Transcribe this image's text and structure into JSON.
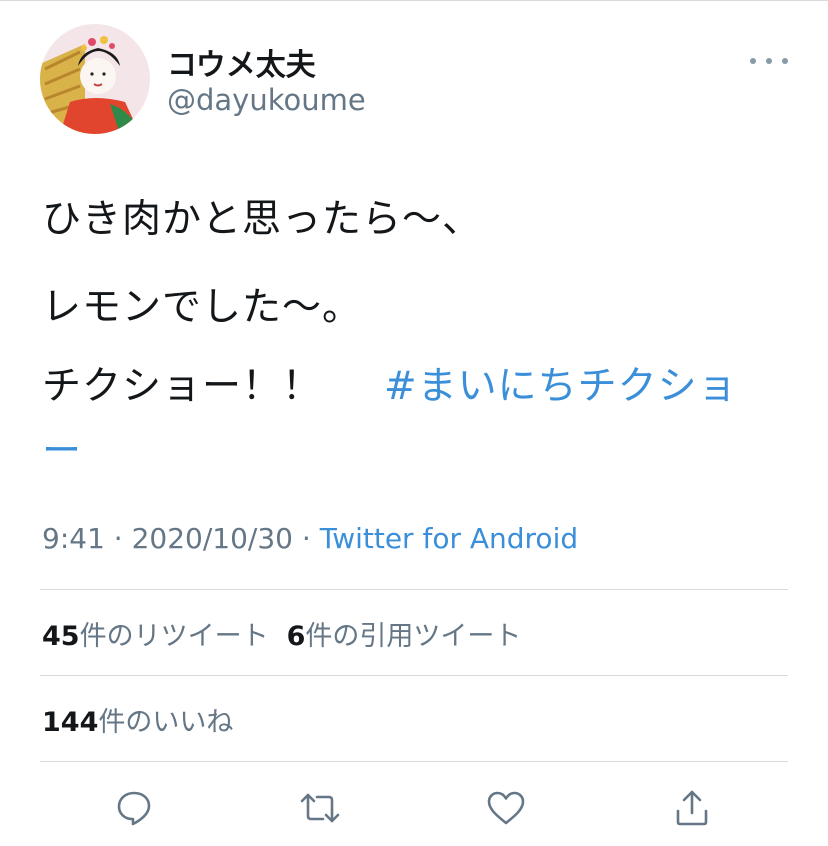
{
  "user": {
    "display_name": "コウメ太夫",
    "handle": "@dayukoume"
  },
  "tweet": {
    "lines": [
      "ひき肉かと思ったら〜、",
      "レモンでした〜。",
      "チクショー！！"
    ],
    "hashtag_part1": "#まいにちチクショ",
    "hashtag_part2": "ー"
  },
  "meta": {
    "time": "9:41",
    "separator": "·",
    "date": "2020/10/30",
    "source": "Twitter for Android"
  },
  "stats": {
    "retweets_count": "45",
    "retweets_label": "件のリツイート",
    "quotes_count": "6",
    "quotes_label": "件の引用ツイート",
    "likes_count": "144",
    "likes_label": "件のいいね"
  },
  "icons": {
    "more": "more-horizontal-icon",
    "reply": "reply-icon",
    "retweet": "retweet-icon",
    "like": "heart-icon",
    "share": "share-icon"
  },
  "colors": {
    "link": "#3b8fd9",
    "secondary_text": "#657786",
    "primary_text": "#14171a",
    "icon": "#657786",
    "divider": "#d7dbdf"
  }
}
